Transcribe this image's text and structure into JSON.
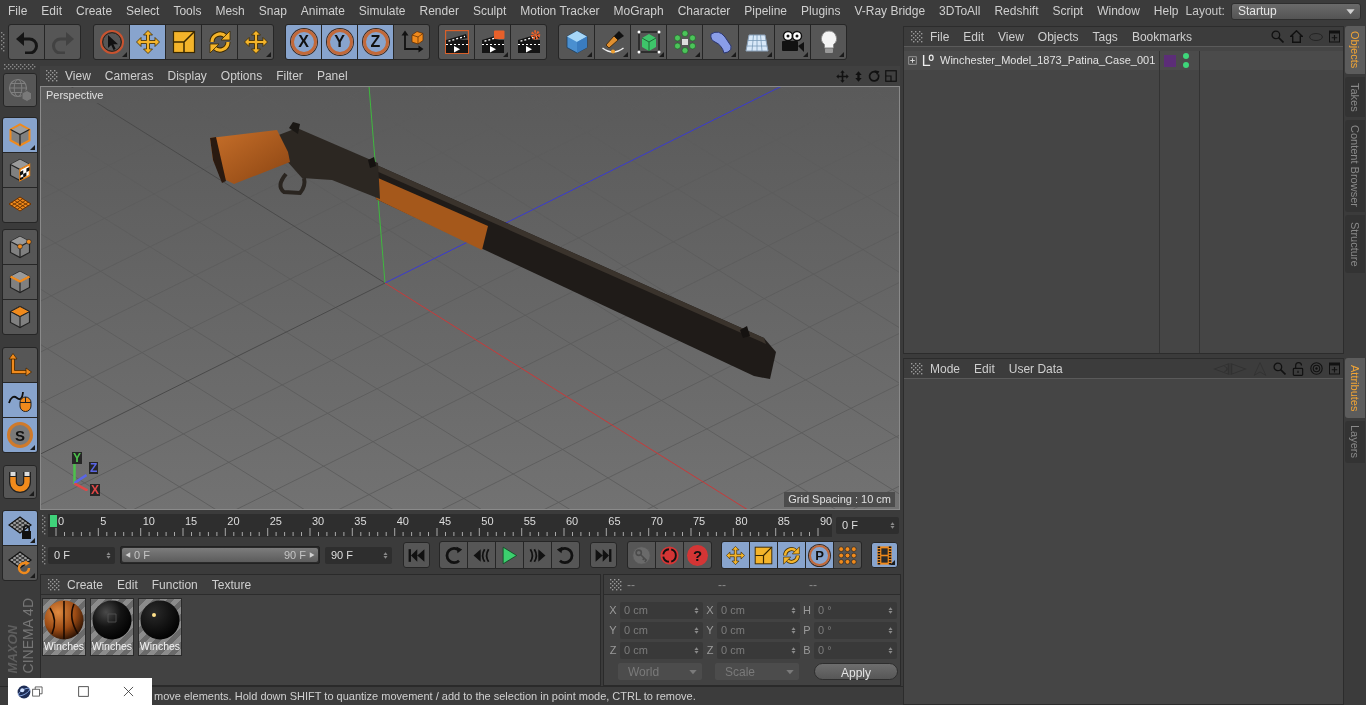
{
  "menu_bar": {
    "items": [
      "File",
      "Edit",
      "Create",
      "Select",
      "Tools",
      "Mesh",
      "Snap",
      "Animate",
      "Simulate",
      "Render",
      "Sculpt",
      "Motion Tracker",
      "MoGraph",
      "Character",
      "Pipeline",
      "Plugins",
      "V-Ray Bridge",
      "3DToAll",
      "Redshift",
      "Script",
      "Window",
      "Help"
    ],
    "layout_label": "Layout:",
    "layout_value": "Startup"
  },
  "toolbar": {
    "groups": [
      {
        "buttons": [
          {
            "selected": false,
            "disabled": false
          },
          {
            "selected": false,
            "disabled": true
          }
        ]
      },
      {
        "buttons": [
          {
            "selected": false
          },
          {
            "selected": true
          },
          {
            "selected": false
          },
          {
            "selected": false
          },
          {
            "selected": false
          }
        ]
      },
      {
        "buttons": [
          {
            "label": "X",
            "selected": true
          },
          {
            "label": "Y",
            "selected": true
          },
          {
            "label": "Z",
            "selected": true
          },
          {
            "selected": false
          }
        ]
      },
      {
        "buttons": [
          {
            "selected": false
          },
          {
            "selected": false
          },
          {
            "selected": false
          }
        ]
      },
      {
        "buttons": [
          {
            "selected": false
          },
          {
            "selected": false
          },
          {
            "selected": false
          },
          {
            "selected": false
          },
          {
            "selected": false
          },
          {
            "selected": false
          },
          {
            "selected": false
          },
          {
            "selected": false
          }
        ]
      }
    ]
  },
  "left_toolbar": {
    "groups": [
      {
        "buttons": [
          {
            "selected": false,
            "disabled": true
          }
        ]
      },
      {
        "buttons": [
          {
            "selected": true
          },
          {
            "selected": false
          },
          {
            "selected": false
          }
        ]
      },
      {
        "buttons": [
          {
            "selected": false
          },
          {
            "selected": false
          },
          {
            "selected": false
          }
        ]
      },
      {
        "buttons": [
          {
            "selected": false
          },
          {
            "selected": true
          },
          {
            "label": "S",
            "selected": true
          }
        ]
      },
      {
        "buttons": [
          {
            "selected": false
          }
        ]
      },
      {
        "buttons": [
          {
            "selected": true
          },
          {
            "selected": false
          }
        ]
      }
    ]
  },
  "viewport": {
    "menu": [
      "View",
      "Cameras",
      "Display",
      "Options",
      "Filter",
      "Panel"
    ],
    "camera": "Perspective",
    "axis_labels": [
      {
        "text": "Y",
        "color": "#4cc24c"
      },
      {
        "text": "Z",
        "color": "#5a66e6"
      },
      {
        "text": "X",
        "color": "#e04848"
      }
    ],
    "grid_spacing": "Grid Spacing : 10 cm"
  },
  "timeline": {
    "marks": [
      {
        "label": "0",
        "selected": true
      },
      {
        "label": "5",
        "selected": false
      },
      {
        "label": "10",
        "selected": false
      },
      {
        "label": "15",
        "selected": false
      },
      {
        "label": "20",
        "selected": false
      },
      {
        "label": "25",
        "selected": false
      },
      {
        "label": "30",
        "selected": false
      },
      {
        "label": "35",
        "selected": false
      },
      {
        "label": "40",
        "selected": false
      },
      {
        "label": "45",
        "selected": false
      },
      {
        "label": "50",
        "selected": false
      },
      {
        "label": "55",
        "selected": false
      },
      {
        "label": "60",
        "selected": false
      },
      {
        "label": "65",
        "selected": false
      },
      {
        "label": "70",
        "selected": false
      },
      {
        "label": "75",
        "selected": false
      },
      {
        "label": "80",
        "selected": false
      },
      {
        "label": "85",
        "selected": false
      },
      {
        "label": "90",
        "selected": false
      }
    ],
    "current_frame": "0 F"
  },
  "transport": {
    "start_frame": "0 F",
    "range": {
      "start": "0 F",
      "end": "90 F",
      "level": 1
    },
    "end_frame": "90 F",
    "groups": [
      {
        "buttons": [
          {
            "selected": false
          }
        ]
      },
      {
        "buttons": [
          {
            "selected": false
          },
          {
            "selected": false
          },
          {
            "selected": false
          },
          {
            "selected": false
          },
          {
            "selected": false
          }
        ]
      },
      {
        "buttons": [
          {
            "selected": false
          }
        ]
      },
      {
        "buttons": [
          {
            "selected": false,
            "disabled": true
          },
          {
            "selected": false,
            "disabled": false
          },
          {
            "label": "?",
            "selected": false,
            "disabled": false
          }
        ]
      },
      {
        "buttons": [
          {
            "selected": true
          },
          {
            "selected": true
          },
          {
            "selected": true
          },
          {
            "label": "P",
            "selected": true
          },
          {
            "selected": false
          }
        ]
      },
      {
        "buttons": [
          {
            "selected": true
          }
        ]
      }
    ]
  },
  "material_manager": {
    "menu": [
      "Create",
      "Edit",
      "Function",
      "Texture"
    ],
    "materials": [
      {
        "name": "Winches",
        "selected": false
      },
      {
        "name": "Winches",
        "selected": false
      },
      {
        "name": "Winches",
        "selected": false
      }
    ]
  },
  "coordinates": {
    "headers": [
      "--",
      "--",
      "--"
    ],
    "disabled": true,
    "rows": [
      {
        "cells": [
          {
            "axis": "X",
            "value": "0 cm"
          },
          {
            "axis": "X",
            "value": "0 cm"
          },
          {
            "axis": "H",
            "value": "0 °"
          }
        ]
      },
      {
        "cells": [
          {
            "axis": "Y",
            "value": "0 cm"
          },
          {
            "axis": "Y",
            "value": "0 cm"
          },
          {
            "axis": "P",
            "value": "0 °"
          }
        ]
      },
      {
        "cells": [
          {
            "axis": "Z",
            "value": "0 cm"
          },
          {
            "axis": "Z",
            "value": "0 cm"
          },
          {
            "axis": "B",
            "value": "0 °"
          }
        ]
      }
    ],
    "dropdowns": [
      "World",
      "Scale"
    ],
    "apply": "Apply"
  },
  "status_bar": {
    "text": "move elements. Hold down SHIFT to quantize movement / add to the selection in point mode, CTRL to remove."
  },
  "object_manager": {
    "menu": [
      "File",
      "Edit",
      "View",
      "Objects",
      "Tags",
      "Bookmarks"
    ],
    "objects": [
      {
        "name": "Winchester_Model_1873_Patina_Case_001",
        "expanded": false,
        "color": "#5c2d78",
        "editor_visible": true,
        "render_visible": true
      }
    ]
  },
  "side_tabs_top": [
    {
      "label": "Objects",
      "selected": true
    },
    {
      "label": "Takes",
      "selected": false
    },
    {
      "label": "Content Browser",
      "selected": false
    },
    {
      "label": "Structure",
      "selected": false
    }
  ],
  "attributes": {
    "menu": [
      "Mode",
      "Edit",
      "User Data"
    ],
    "tools": [
      {
        "disabled": true
      },
      {
        "disabled": true
      },
      {
        "disabled": false
      },
      {
        "disabled": false
      },
      {
        "disabled": false
      },
      {
        "disabled": false
      }
    ]
  },
  "side_tabs_bottom": [
    {
      "label": "Attributes",
      "selected": true
    },
    {
      "label": "Layers",
      "selected": false
    }
  ],
  "logo": {
    "brand": "MAXON",
    "product": "CINEMA 4D"
  }
}
